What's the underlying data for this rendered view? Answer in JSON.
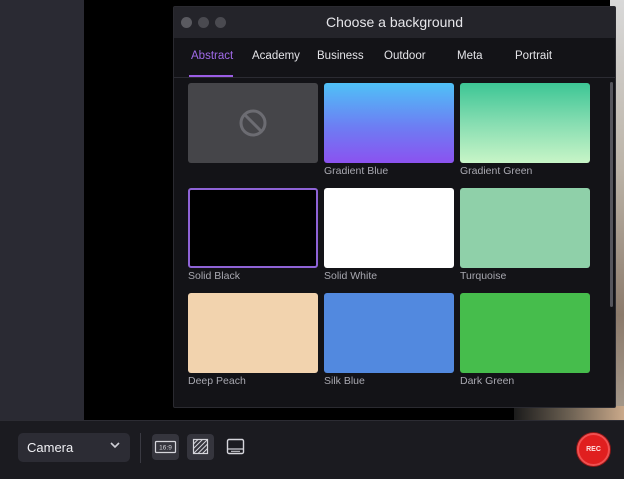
{
  "dialog": {
    "title": "Choose a background",
    "tabs": [
      {
        "label": "Abstract",
        "active": true
      },
      {
        "label": "Academy",
        "active": false
      },
      {
        "label": "Business",
        "active": false
      },
      {
        "label": "Outdoor",
        "active": false
      },
      {
        "label": "Meta",
        "active": false
      },
      {
        "label": "Portrait",
        "active": false
      }
    ],
    "backgrounds": [
      {
        "label": "",
        "icon": "no-background-icon"
      },
      {
        "label": "Gradient Blue",
        "color": "#5b6af5"
      },
      {
        "label": "Gradient Green",
        "color": "#5fd6a0"
      },
      {
        "label": "Solid Black",
        "color": "#000000",
        "selected": true
      },
      {
        "label": "Solid White",
        "color": "#ffffff"
      },
      {
        "label": "Turquoise",
        "color": "#8fd0a9"
      },
      {
        "label": "Deep Peach",
        "color": "#f2d3ae"
      },
      {
        "label": "Silk Blue",
        "color": "#5289df"
      },
      {
        "label": "Dark Green",
        "color": "#46bd4c"
      }
    ]
  },
  "toolbar": {
    "camera_select": "Camera",
    "aspect_label": "16:9",
    "rec_label": "REC"
  },
  "colors": {
    "accent": "#9b5de5",
    "record": "#e01f1f"
  }
}
